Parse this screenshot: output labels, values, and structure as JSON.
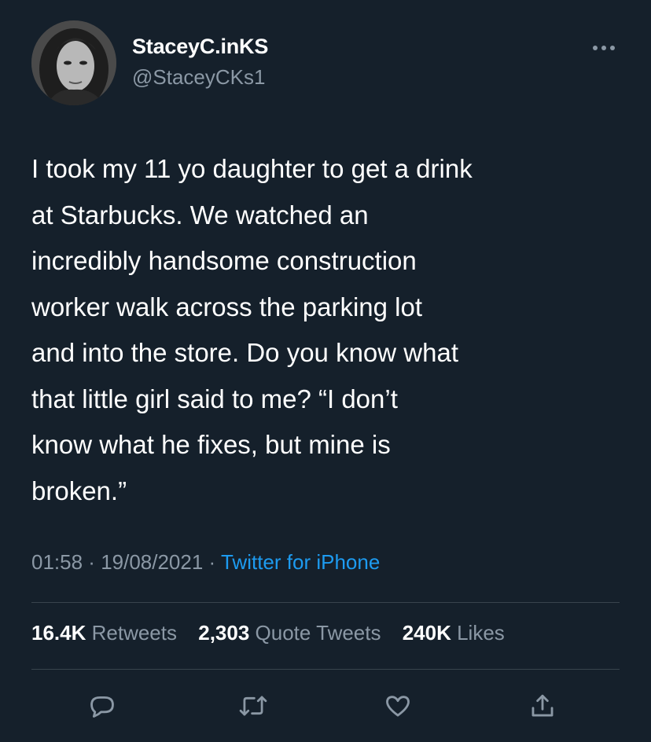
{
  "author": {
    "display_name": "StaceyC.inKS",
    "handle": "@StaceyCKs1",
    "avatar_icon": "profile-photo"
  },
  "tweet": {
    "text": "I took my 11 yo daughter to get a drink\nat Starbucks. We watched an\nincredibly handsome construction\nworker walk across the parking lot\nand into the store. Do you know what\nthat little girl said to me? “I don’t\nknow what he fixes, but mine is\nbroken.”",
    "time": "01:58",
    "separator": " · ",
    "date": "19/08/2021",
    "source": "Twitter for iPhone"
  },
  "stats": {
    "retweets_count": "16.4K",
    "retweets_label": " Retweets",
    "quotes_count": "2,303",
    "quotes_label": " Quote Tweets",
    "likes_count": "240K",
    "likes_label": " Likes"
  },
  "actions": [
    "reply-icon",
    "retweet-icon",
    "like-icon",
    "share-icon"
  ],
  "colors": {
    "background": "#15202b",
    "text": "#ffffff",
    "muted": "#8b98a5",
    "link": "#1d9bf0",
    "divider": "#38444d"
  }
}
